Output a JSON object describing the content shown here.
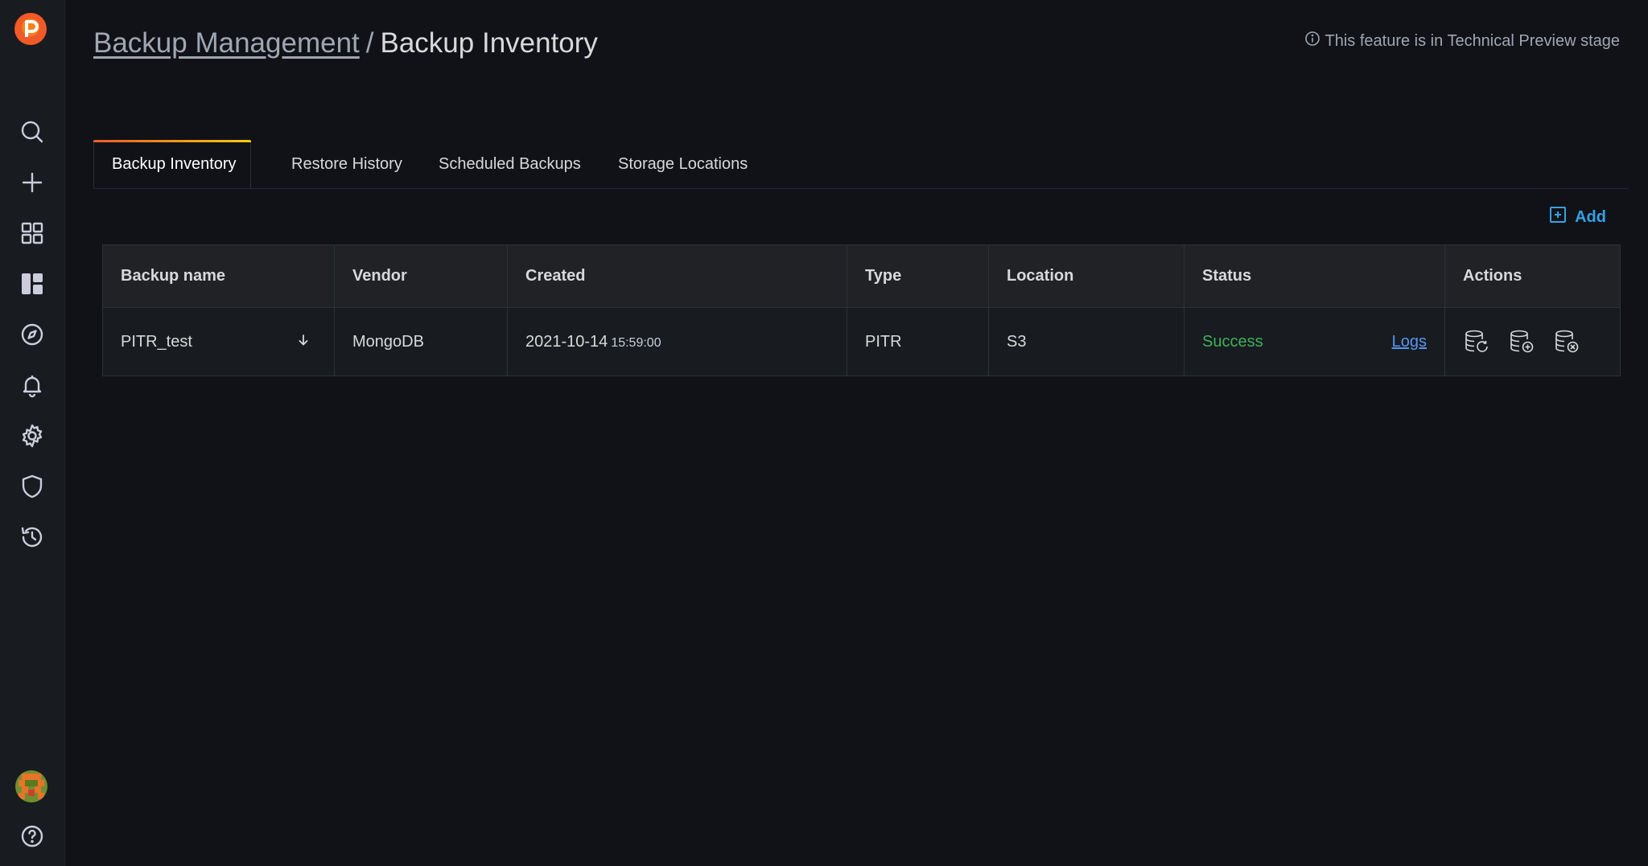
{
  "breadcrumb": {
    "parent": "Backup Management",
    "separator": "/",
    "current": "Backup Inventory"
  },
  "preview_notice": "This feature is in Technical Preview stage",
  "tabs": [
    {
      "label": "Backup Inventory",
      "active": true
    },
    {
      "label": "Restore History",
      "active": false
    },
    {
      "label": "Scheduled Backups",
      "active": false
    },
    {
      "label": "Storage Locations",
      "active": false
    }
  ],
  "add_label": "Add",
  "table": {
    "columns": [
      "Backup name",
      "Vendor",
      "Created",
      "Type",
      "Location",
      "Status",
      "Actions"
    ],
    "rows": [
      {
        "name": "PITR_test",
        "vendor": "MongoDB",
        "created_date": "2021-10-14",
        "created_time": "15:59:00",
        "type": "PITR",
        "location": "S3",
        "status": "Success",
        "logs": "Logs"
      }
    ]
  },
  "sidebar_icons": [
    "search-icon",
    "plus-icon",
    "dashboards-icon",
    "panels-icon",
    "explore-icon",
    "bell-icon",
    "gear-icon",
    "shield-icon",
    "history-icon",
    "help-icon"
  ],
  "colors": {
    "accent": "#33a2e5",
    "success": "#3eb15b",
    "link": "#5794f2",
    "logo": "#f05a28"
  }
}
